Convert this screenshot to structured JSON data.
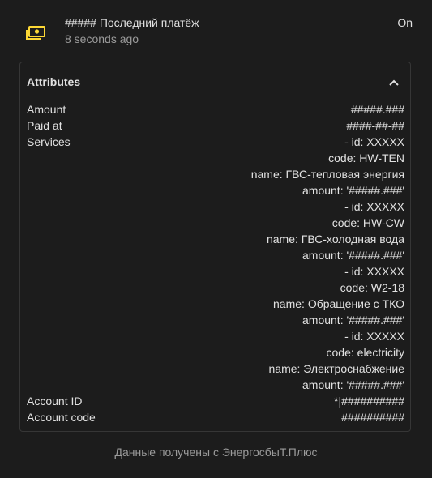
{
  "entity": {
    "name": "##### Последний платёж",
    "last_changed": "8 seconds ago",
    "state": "On",
    "icon": "cash-icon",
    "icon_color": "#fdd835"
  },
  "attributes": {
    "title": "Attributes",
    "amount": {
      "key": "Amount",
      "value": "#####.###"
    },
    "paid_at": {
      "key": "Paid at",
      "value": "####-##-##"
    },
    "services": {
      "key": "Services",
      "lines": [
        "- id: XXXXX",
        "code: HW-TEN",
        "name: ГВС-тепловая энергия",
        "amount: '#####.###'",
        "- id: XXXXX",
        "code: HW-CW",
        "name: ГВС-холодная вода",
        "amount: '#####.###'",
        "- id: XXXXX",
        "code: W2-18",
        "name: Обращение с ТКО",
        "amount: '#####.###'",
        "- id: XXXXX",
        "code: electricity",
        "name: Электроснабжение",
        "amount: '#####.###'"
      ]
    },
    "account_id": {
      "key": "Account ID",
      "value": "*|##########"
    },
    "account_code": {
      "key": "Account code",
      "value": "##########"
    }
  },
  "attribution": "Данные получены с ЭнергосбыТ.Плюс"
}
